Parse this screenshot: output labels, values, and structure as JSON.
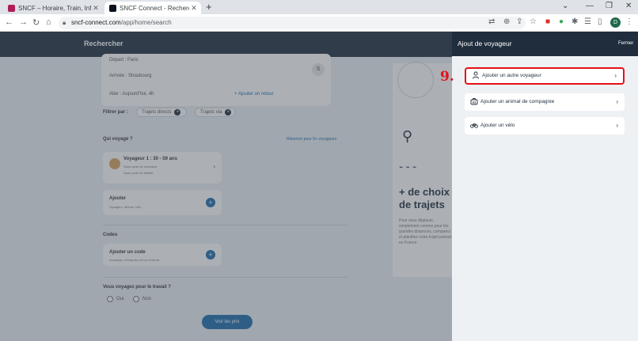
{
  "browser": {
    "tabs": [
      {
        "title": "SNCF – Horaire, Train, Info Trafic",
        "active": false
      },
      {
        "title": "SNCF Connect - Recherche",
        "active": true
      }
    ],
    "new_tab": "+",
    "url_host": "sncf-connect.com",
    "url_path": "/app/home/search",
    "profile_initial": "D"
  },
  "page": {
    "header_title": "Rechercher",
    "search": {
      "depart": "Départ : Paris",
      "arrivee": "Arrivée : Strasbourg",
      "aller": "Aller : Aujourd'hui, 4h",
      "retour": "+ Ajouter un retour"
    },
    "filtrer_label": "Filtrer par :",
    "filters": [
      "Trajets directs",
      "Trajets via"
    ],
    "qui_voyage": "Qui voyage ?",
    "reserver_link": "Réserver pour 9+ voyageurs",
    "voyageur_card": {
      "title": "Voyageur 1 : 30 - 59 ans",
      "line1": "Sans carte de réduction",
      "line2": "Sans carte de fidélité"
    },
    "ajouter_card": {
      "title": "Ajouter",
      "sub": "Voyageur, animal, vélo"
    },
    "codes_label": "Codes",
    "code_card": {
      "title": "Ajouter un code",
      "sub": "Avantage, entreprise et bon d'achat"
    },
    "travel_question": "Vous voyagez pour le travail ?",
    "radio_options": [
      "Oui",
      "Non"
    ],
    "submit_button": "Voir les prix",
    "promo": {
      "title": "+ de choix de trajets",
      "text": "Pour vous déplacer, simplement comme pour les grandes distances, comparez et planifiez votre trajet partout en France"
    }
  },
  "panel": {
    "title": "Ajout de voyageur",
    "close_label": "Fermer",
    "options": [
      {
        "label": "Ajouter un autre voyageur",
        "icon": "person-icon"
      },
      {
        "label": "Ajouter un animal de compagnie",
        "icon": "pet-carrier-icon"
      },
      {
        "label": "Ajouter un vélo",
        "icon": "bicycle-icon"
      }
    ]
  },
  "annotation": {
    "step_number": "9.",
    "highlight_color": "#e41018"
  },
  "colors": {
    "header_navy": "#1f2d3d",
    "accent_blue": "#1a6aa8"
  }
}
